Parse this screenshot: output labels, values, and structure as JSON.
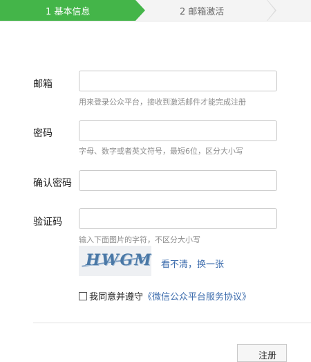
{
  "steps": [
    {
      "label": "1 基本信息",
      "active": true
    },
    {
      "label": "2 邮箱激活",
      "active": false
    }
  ],
  "form": {
    "email": {
      "label": "邮箱",
      "value": "",
      "hint": "用来登录公众平台，接收到激活邮件才能完成注册"
    },
    "password": {
      "label": "密码",
      "value": "",
      "hint": "字母、数字或者英文符号，最短6位，区分大小写"
    },
    "confirm_password": {
      "label": "确认密码",
      "value": ""
    },
    "captcha": {
      "label": "验证码",
      "value": "",
      "hint": "输入下面图片的字符，不区分大小写",
      "image_text": "HWGM",
      "refresh_label": "看不清，换一张"
    }
  },
  "agreement": {
    "prefix": "我同意并遵守",
    "link_text": "《微信公众平台服务协议》",
    "checked": false
  },
  "submit_label": "注册",
  "colors": {
    "accent": "#44b549",
    "link": "#3c6cad"
  }
}
